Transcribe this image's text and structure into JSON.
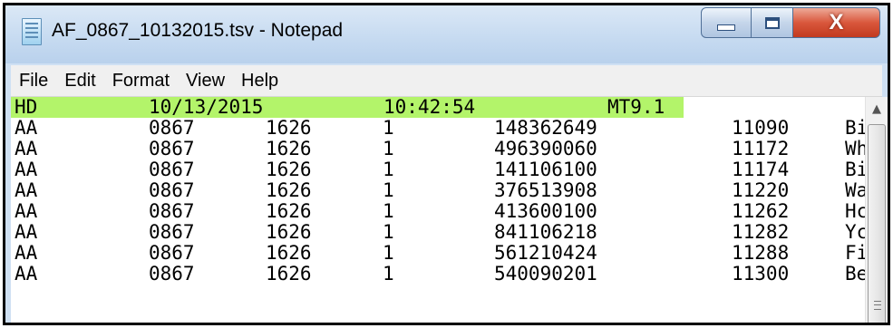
{
  "window": {
    "title": "AF_0867_10132015.tsv - Notepad",
    "close_glyph": "X"
  },
  "menu": [
    "File",
    "Edit",
    "Format",
    "View",
    "Help"
  ],
  "colors": {
    "header_highlight": "#b3f46a"
  },
  "header_row": [
    "HD",
    "10/13/2015",
    "10:42:54",
    "MT9.1"
  ],
  "rows": [
    [
      "AA",
      "0867",
      "1626",
      "1",
      "148362649",
      "11090",
      "Bi"
    ],
    [
      "AA",
      "0867",
      "1626",
      "1",
      "496390060",
      "11172",
      "Wh"
    ],
    [
      "AA",
      "0867",
      "1626",
      "1",
      "141106100",
      "11174",
      "Bi"
    ],
    [
      "AA",
      "0867",
      "1626",
      "1",
      "376513908",
      "11220",
      "Wa"
    ],
    [
      "AA",
      "0867",
      "1626",
      "1",
      "413600100",
      "11262",
      "Hc"
    ],
    [
      "AA",
      "0867",
      "1626",
      "1",
      "841106218",
      "11282",
      "Yc"
    ],
    [
      "AA",
      "0867",
      "1626",
      "1",
      "561210424",
      "11288",
      "Fi"
    ],
    [
      "AA",
      "0867",
      "1626",
      "1",
      "540090201",
      "11300",
      "Be"
    ]
  ]
}
